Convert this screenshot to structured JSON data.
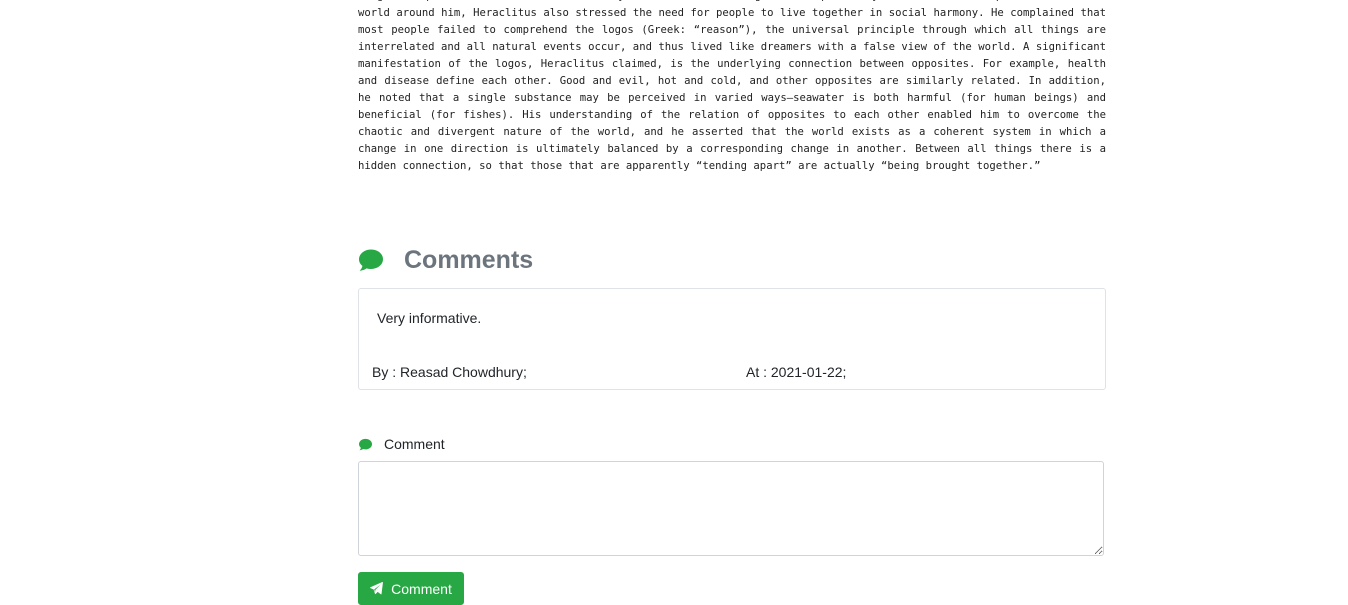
{
  "article": {
    "text": "fragments quoted and attributed to him by later authors. Though he was primarily concerned with explanations of the world around him, Heraclitus also stressed the need for people to live together in social harmony. He complained that most people failed to comprehend the logos (Greek: “reason”), the universal principle through which all things are interrelated and all natural events occur, and thus lived like dreamers with a false view of the world. A significant manifestation of the logos, Heraclitus claimed, is the underlying connection between opposites. For example, health and disease define each other. Good and evil, hot and cold, and other opposites are similarly related. In addition, he noted that a single substance may be perceived in varied ways—seawater is both harmful (for human beings) and beneficial (for fishes). His understanding of the relation of opposites to each other enabled him to overcome the chaotic and divergent nature of the world, and he asserted that the world exists as a coherent system in which a change in one direction is ultimately balanced by a corresponding change in another. Between all things there is a hidden connection, so that those that are apparently “tending apart” are actually “being brought together.”"
  },
  "comments": {
    "heading": "Comments",
    "icon": "comments-icon",
    "accent_color": "#28a745",
    "heading_color": "#6c757d",
    "items": [
      {
        "body": "Very informative.",
        "author_line": "By : Reasad Chowdhury;",
        "date_line": "At : 2021-01-22;"
      }
    ]
  },
  "comment_form": {
    "label": "Comment",
    "label_icon": "comment-icon",
    "textarea_value": "",
    "textarea_placeholder": "",
    "submit_label": "Comment",
    "submit_icon": "paper-plane-icon",
    "submit_color": "#28a745"
  }
}
